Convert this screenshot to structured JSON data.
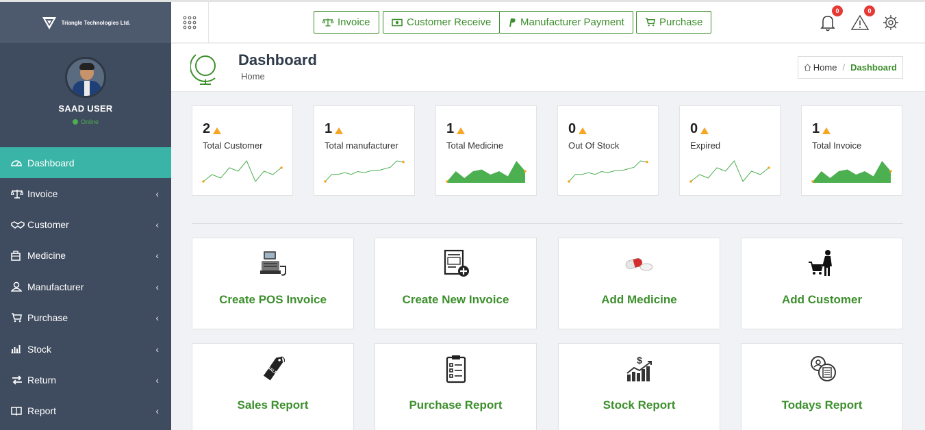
{
  "brand": {
    "name": "Triangle Technologies Ltd."
  },
  "user": {
    "name": "SAAD USER",
    "status": "Online"
  },
  "sidebar": {
    "items": [
      {
        "label": "Dashboard",
        "icon": "dashboard-icon",
        "active": true
      },
      {
        "label": "Invoice",
        "icon": "balance-scale-icon"
      },
      {
        "label": "Customer",
        "icon": "handshake-icon"
      },
      {
        "label": "Medicine",
        "icon": "medical-bag-icon"
      },
      {
        "label": "Manufacturer",
        "icon": "user-icon"
      },
      {
        "label": "Purchase",
        "icon": "cart-icon"
      },
      {
        "label": "Stock",
        "icon": "bar-chart-icon"
      },
      {
        "label": "Return",
        "icon": "exchange-icon"
      },
      {
        "label": "Report",
        "icon": "book-icon"
      }
    ]
  },
  "topbar": {
    "quick": [
      {
        "label": "Invoice",
        "icon": "balance-scale-icon"
      },
      {
        "label": "Customer Receive",
        "icon": "money-icon"
      },
      {
        "label": "Manufacturer Payment",
        "icon": "paypal-icon"
      },
      {
        "label": "Purchase",
        "icon": "cart-icon"
      }
    ],
    "notifications": {
      "count": "0"
    },
    "alerts": {
      "count": "0"
    }
  },
  "header": {
    "title": "Dashboard",
    "subtitle": "Home",
    "breadcrumb": {
      "home": "Home",
      "current": "Dashboard"
    }
  },
  "stats": [
    {
      "value": "2",
      "label": "Total Customer",
      "spark": "line",
      "points": [
        2,
        4,
        3,
        6,
        5,
        8,
        2,
        5,
        4,
        6
      ]
    },
    {
      "value": "1",
      "label": "Total manufacturer",
      "spark": "line",
      "points": [
        1,
        3,
        3,
        3.5,
        3,
        3.8,
        3.5,
        4,
        4,
        4.5,
        5,
        6.8,
        6.5
      ]
    },
    {
      "value": "1",
      "label": "Total Medicine",
      "spark": "area",
      "points": [
        1,
        4,
        2,
        4,
        4.5,
        3,
        4,
        2.5,
        7,
        4
      ]
    },
    {
      "value": "0",
      "label": "Out Of Stock",
      "spark": "line",
      "points": [
        1,
        3,
        3,
        3.5,
        3,
        3.8,
        3.5,
        4,
        4,
        4.5,
        5,
        6.8,
        6.5
      ]
    },
    {
      "value": "0",
      "label": "Expired",
      "spark": "line",
      "points": [
        2,
        4,
        3,
        6,
        5,
        8,
        2,
        5,
        4,
        6
      ]
    },
    {
      "value": "1",
      "label": "Total Invoice",
      "spark": "area",
      "points": [
        1,
        4,
        2,
        4,
        4.5,
        3,
        4,
        2.5,
        7,
        4
      ]
    }
  ],
  "tiles": [
    {
      "label": "Create POS Invoice",
      "icon": "pos-terminal-icon"
    },
    {
      "label": "Create New Invoice",
      "icon": "new-invoice-icon"
    },
    {
      "label": "Add Medicine",
      "icon": "pill-icon"
    },
    {
      "label": "Add Customer",
      "icon": "shopper-icon"
    },
    {
      "label": "Sales Report",
      "icon": "sale-tag-icon"
    },
    {
      "label": "Purchase Report",
      "icon": "clipboard-icon"
    },
    {
      "label": "Stock Report",
      "icon": "money-chart-icon"
    },
    {
      "label": "Todays Report",
      "icon": "report-docs-icon"
    }
  ],
  "colors": {
    "sidebar": "#3f4b5e",
    "active": "#3ab4a6",
    "accent": "#3c8f2c",
    "spark": "#4caf50",
    "badge": "#e53935"
  }
}
